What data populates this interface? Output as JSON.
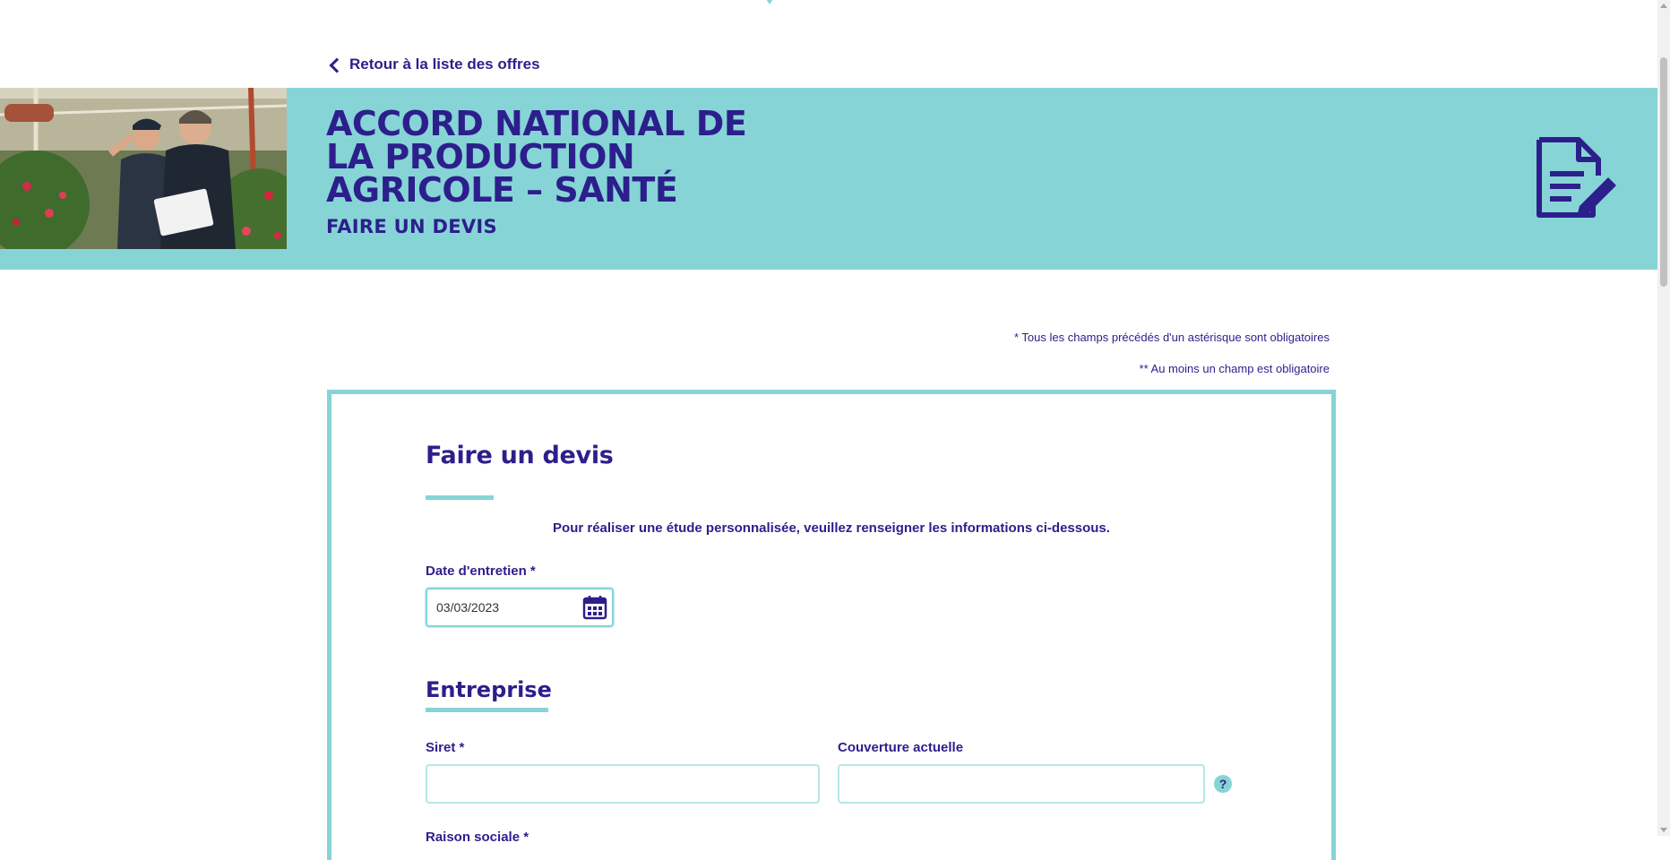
{
  "nav": {
    "back_label": "Retour à la liste des offres"
  },
  "banner": {
    "title": "ACCORD NATIONAL DE LA PRODUCTION AGRICOLE – SANTÉ",
    "subtitle": "FAIRE UN DEVIS",
    "photo_subject": "two men inspecting plants in a greenhouse",
    "icon": "document-edit-icon"
  },
  "notes": {
    "required": "* Tous les champs précédés d'un astérisque sont obligatoires",
    "at_least_one": "** Au moins un champ est obligatoire"
  },
  "form": {
    "title": "Faire un devis",
    "intro": "Pour réaliser une étude personnalisée, veuillez renseigner les informations ci-dessous.",
    "date_label": "Date d'entretien *",
    "date_value": "03/03/2023",
    "section_company": "Entreprise",
    "siret_label": "Siret *",
    "siret_value": "",
    "couverture_label": "Couverture actuelle",
    "couverture_value": "",
    "help_symbol": "?",
    "raison_label": "Raison sociale *"
  },
  "colors": {
    "brand": "#2c1f8c",
    "accent": "#86d4d6"
  }
}
